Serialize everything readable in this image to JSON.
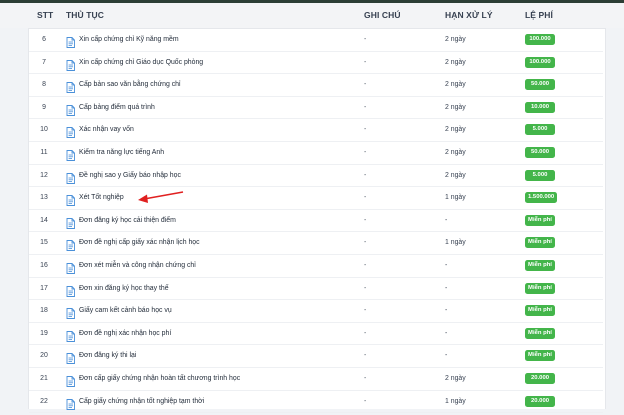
{
  "header": {
    "stt": "STT",
    "procedure": "THỦ TỤC",
    "note": "GHI CHÚ",
    "deadline": "HẠN XỬ LÝ",
    "fee": "LỆ PHÍ"
  },
  "rows": [
    {
      "stt": "6",
      "name": "Xin cấp chứng chỉ Kỹ năng mềm",
      "note": "-",
      "deadline": "2 ngày",
      "fee": "100.000"
    },
    {
      "stt": "7",
      "name": "Xin cấp chứng chỉ Giáo dục Quốc phòng",
      "note": "-",
      "deadline": "2 ngày",
      "fee": "100.000"
    },
    {
      "stt": "8",
      "name": "Cấp bản sao văn bằng chứng chỉ",
      "note": "-",
      "deadline": "2 ngày",
      "fee": "50.000"
    },
    {
      "stt": "9",
      "name": "Cấp bảng điểm quá trình",
      "note": "-",
      "deadline": "2 ngày",
      "fee": "10.000"
    },
    {
      "stt": "10",
      "name": "Xác nhận vay vốn",
      "note": "-",
      "deadline": "2 ngày",
      "fee": "5.000"
    },
    {
      "stt": "11",
      "name": "Kiểm tra năng lực tiếng Anh",
      "note": "-",
      "deadline": "2 ngày",
      "fee": "50.000"
    },
    {
      "stt": "12",
      "name": "Đề nghị sao y Giấy báo nhập học",
      "note": "-",
      "deadline": "2 ngày",
      "fee": "5.000"
    },
    {
      "stt": "13",
      "name": "Xét Tốt nghiệp",
      "note": "-",
      "deadline": "1 ngày",
      "fee": "1.500.000"
    },
    {
      "stt": "14",
      "name": "Đơn đăng ký học cải thiện điểm",
      "note": "-",
      "deadline": "-",
      "fee": "Miễn phí"
    },
    {
      "stt": "15",
      "name": "Đơn đề nghị cấp giấy xác nhận lịch học",
      "note": "-",
      "deadline": "1 ngày",
      "fee": "Miễn phí"
    },
    {
      "stt": "16",
      "name": "Đơn xét miễn và công nhận chứng chỉ",
      "note": "-",
      "deadline": "-",
      "fee": "Miễn phí"
    },
    {
      "stt": "17",
      "name": "Đơn xin đăng ký học thay thế",
      "note": "-",
      "deadline": "-",
      "fee": "Miễn phí"
    },
    {
      "stt": "18",
      "name": "Giấy cam kết cảnh báo học vụ",
      "note": "-",
      "deadline": "-",
      "fee": "Miễn phí"
    },
    {
      "stt": "19",
      "name": "Đơn đề nghị xác nhận học phí",
      "note": "-",
      "deadline": "-",
      "fee": "Miễn phí"
    },
    {
      "stt": "20",
      "name": "Đơn đăng ký thi lại",
      "note": "-",
      "deadline": "-",
      "fee": "Miễn phí"
    },
    {
      "stt": "21",
      "name": "Đơn cấp giấy chứng nhận hoàn tất chương trình học",
      "note": "-",
      "deadline": "2 ngày",
      "fee": "20.000"
    },
    {
      "stt": "22",
      "name": "Cấp giấy chứng nhận tốt nghiệp tạm thời",
      "note": "-",
      "deadline": "1 ngày",
      "fee": "20.000"
    }
  ],
  "colors": {
    "fee_badge": "#43b54a",
    "doc_icon": "#4a90d9",
    "arrow": "#e02020"
  },
  "icons": {
    "row_icon": "document-icon",
    "annotation": "red-arrow"
  }
}
